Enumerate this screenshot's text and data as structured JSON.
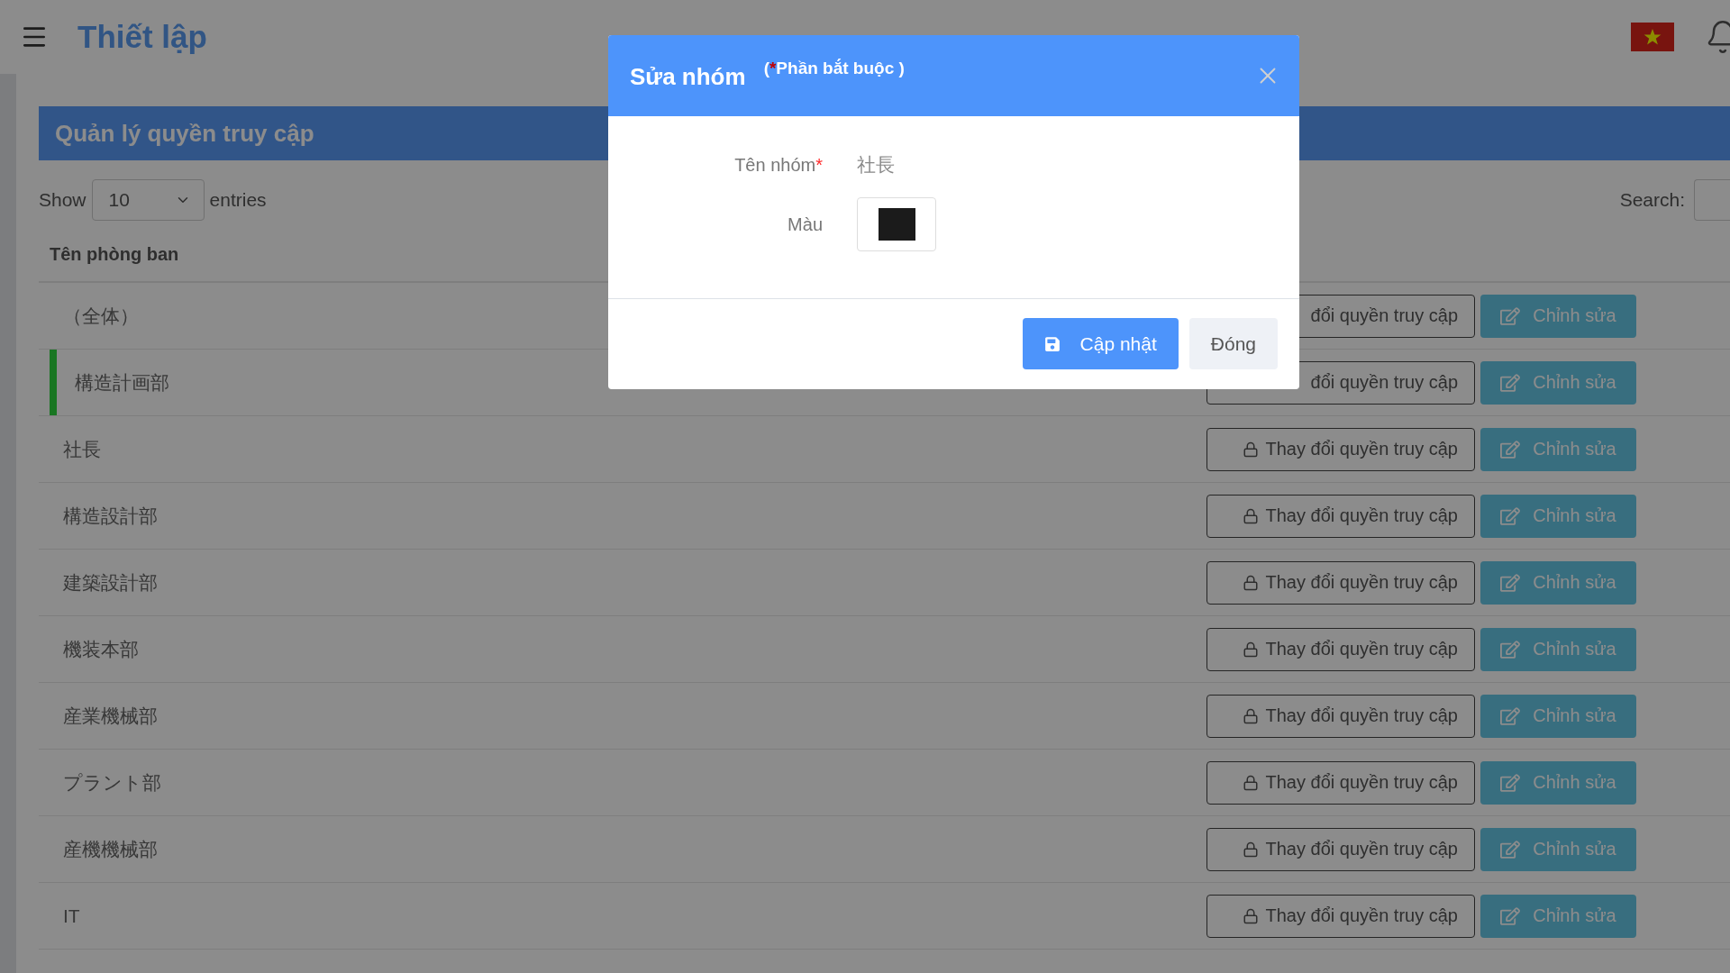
{
  "header": {
    "title": "Thiết lập"
  },
  "panel": {
    "title": "Quản lý quyền truy cập",
    "show_label": "Show",
    "page_size": "10",
    "entries_label": "entries",
    "search_label": "Search:"
  },
  "table": {
    "columns": [
      "Tên phòng ban"
    ],
    "rows": [
      {
        "name": "（全体）",
        "selected": false,
        "access_label": "đổi quyền truy cập",
        "lock_icon": false,
        "edit_label": "Chỉnh sửa"
      },
      {
        "name": "構造計画部",
        "selected": true,
        "access_label": "đổi quyền truy cập",
        "lock_icon": false,
        "edit_label": "Chỉnh sửa"
      },
      {
        "name": "社長",
        "selected": false,
        "access_label": "Thay đổi quyền truy cập",
        "lock_icon": true,
        "edit_label": "Chỉnh sửa"
      },
      {
        "name": "構造設計部",
        "selected": false,
        "access_label": "Thay đổi quyền truy cập",
        "lock_icon": true,
        "edit_label": "Chỉnh sửa"
      },
      {
        "name": "建築設計部",
        "selected": false,
        "access_label": "Thay đổi quyền truy cập",
        "lock_icon": true,
        "edit_label": "Chỉnh sửa"
      },
      {
        "name": "機装本部",
        "selected": false,
        "access_label": "Thay đổi quyền truy cập",
        "lock_icon": true,
        "edit_label": "Chỉnh sửa"
      },
      {
        "name": "産業機械部",
        "selected": false,
        "access_label": "Thay đổi quyền truy cập",
        "lock_icon": true,
        "edit_label": "Chỉnh sửa"
      },
      {
        "name": "プラント部",
        "selected": false,
        "access_label": "Thay đổi quyền truy cập",
        "lock_icon": true,
        "edit_label": "Chỉnh sửa"
      },
      {
        "name": "産機機械部",
        "selected": false,
        "access_label": "Thay đổi quyền truy cập",
        "lock_icon": true,
        "edit_label": "Chỉnh sửa"
      },
      {
        "name": "IT",
        "selected": false,
        "access_label": "Thay đổi quyền truy cập",
        "lock_icon": true,
        "edit_label": "Chỉnh sửa"
      }
    ]
  },
  "dialog": {
    "title": "Sửa nhóm",
    "required_note": {
      "prefix": "(",
      "mark": "*",
      "text": "Phần bắt buộc )"
    },
    "fields": [
      {
        "kind": "text",
        "label": "Tên nhóm",
        "required_mark": "*",
        "value": "社長"
      },
      {
        "kind": "color",
        "label": "Màu",
        "color": "#1b1b1b"
      }
    ],
    "buttons": [
      {
        "kind": "primary",
        "label": "Cập nhật"
      },
      {
        "kind": "secondary",
        "label": "Đóng"
      }
    ]
  }
}
